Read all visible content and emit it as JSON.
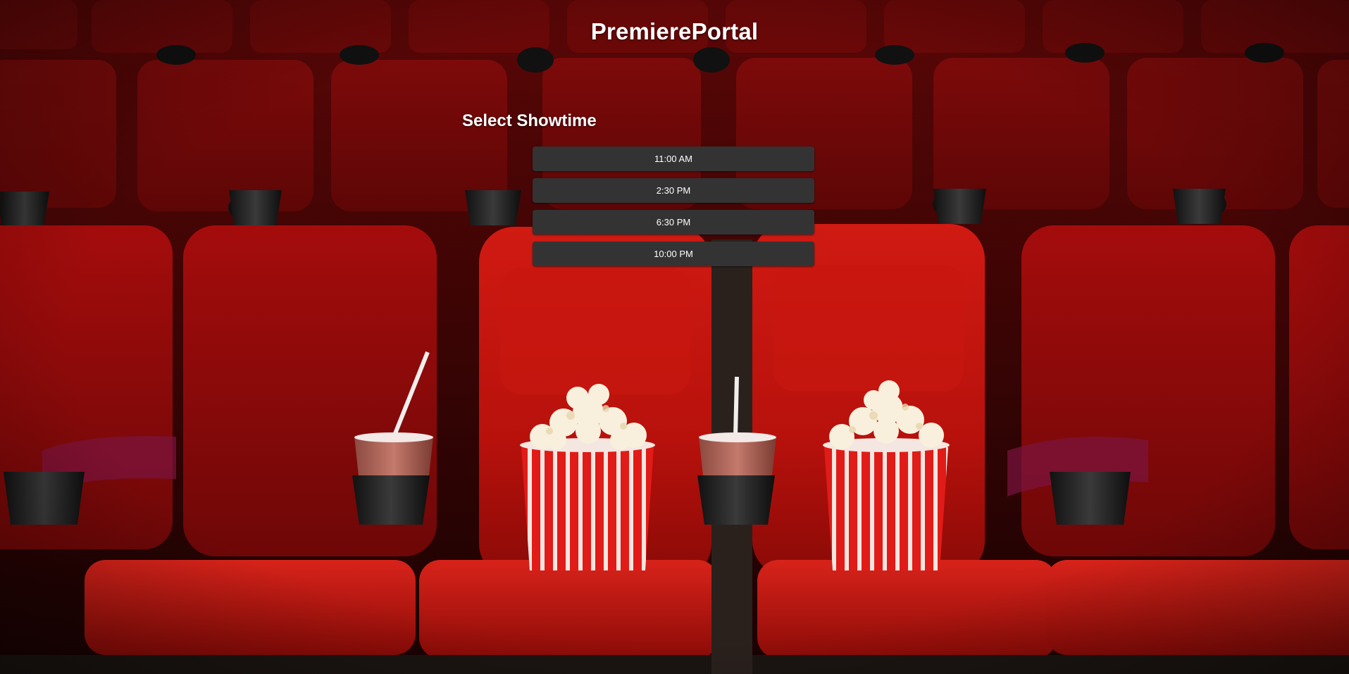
{
  "app": {
    "title": "PremierePortal"
  },
  "showtime_section": {
    "heading": "Select Showtime",
    "times": [
      {
        "label": "11:00 AM"
      },
      {
        "label": "2:30 PM"
      },
      {
        "label": "6:30 PM"
      },
      {
        "label": "10:00 PM"
      }
    ]
  },
  "theme": {
    "seat_red": "#c4150f",
    "button_bg": "#333333",
    "text": "#ffffff"
  }
}
